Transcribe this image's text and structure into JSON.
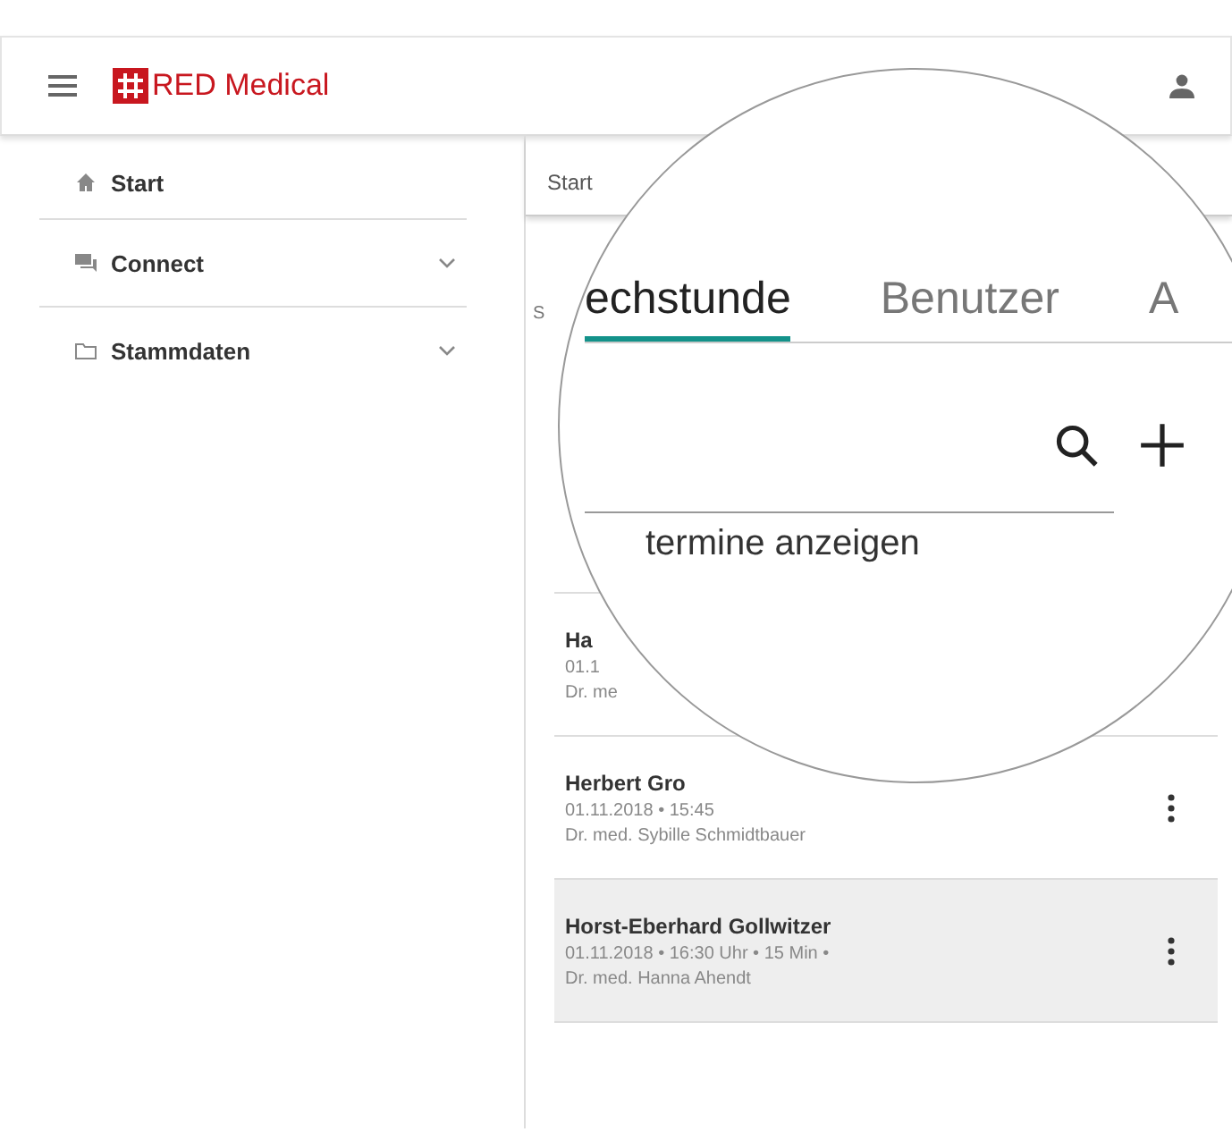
{
  "header": {
    "logo": "RED Medical"
  },
  "sidebar": {
    "items": [
      {
        "label": "Start",
        "kind": "home",
        "expandable": false
      },
      {
        "label": "Connect",
        "kind": "chat",
        "expandable": true
      },
      {
        "label": "Stammdaten",
        "kind": "folder",
        "expandable": true
      }
    ]
  },
  "breadcrumb": "Start",
  "section_label": "S",
  "appointments": [
    {
      "name": "Ha",
      "date_time": "01.1",
      "doctor": "Dr. me",
      "selected": false,
      "menu_visible": false
    },
    {
      "name": "Herbert Gro",
      "date_time": "01.11.2018 • 15:45",
      "doctor": "Dr. med. Sybille Schmidtbauer",
      "selected": false,
      "menu_visible": true
    },
    {
      "name": "Horst-Eberhard Gollwitzer",
      "date_time": "01.11.2018 • 16:30 Uhr • 15 Min •",
      "doctor": "Dr. med. Hanna Ahendt",
      "selected": true,
      "menu_visible": true
    }
  ],
  "magnifier": {
    "tabs": [
      {
        "label": "echstunde",
        "selected": true
      },
      {
        "label": "Benutzer",
        "selected": false
      },
      {
        "label": "A",
        "selected": false
      }
    ],
    "toggle_label": "termine anzeigen"
  }
}
